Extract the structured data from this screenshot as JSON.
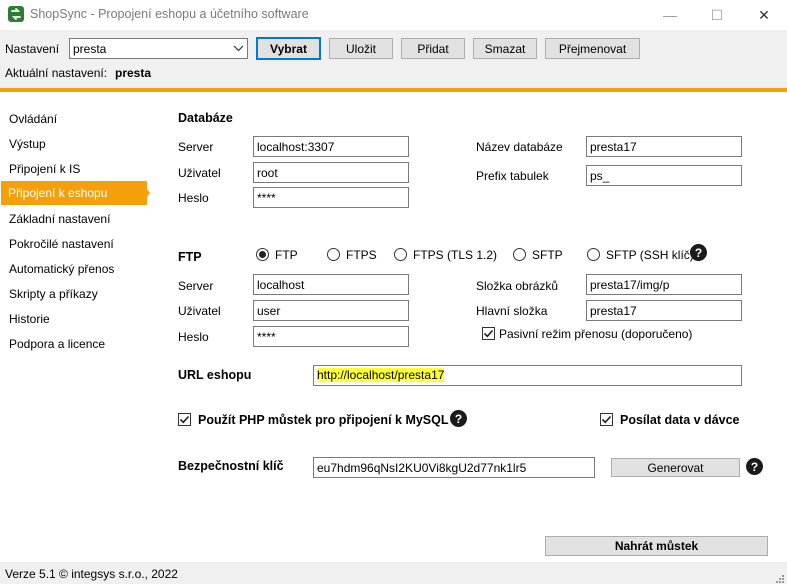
{
  "window": {
    "title": "ShopSync - Propojení eshopu a účetního software",
    "minimize": "—",
    "maximize": "☐",
    "close": "✕"
  },
  "config": {
    "label": "Nastavení",
    "selected": "presta",
    "current_label": "Aktuální nastavení:",
    "current_value": "presta",
    "buttons": {
      "select": "Vybrat",
      "save": "Uložit",
      "add": "Přidat",
      "delete": "Smazat",
      "rename": "Přejmenovat"
    }
  },
  "sidebar": {
    "items": [
      {
        "label": "Ovládání"
      },
      {
        "label": "Výstup"
      },
      {
        "label": "Připojení k IS"
      },
      {
        "label": "Připojení k eshopu"
      },
      {
        "label": "Základní nastavení"
      },
      {
        "label": "Pokročilé nastavení"
      },
      {
        "label": "Automatický přenos"
      },
      {
        "label": "Skripty a příkazy"
      },
      {
        "label": "Historie"
      },
      {
        "label": "Podpora a licence"
      }
    ],
    "active_index": 3
  },
  "database": {
    "heading": "Databáze",
    "server_label": "Server",
    "server": "localhost:3307",
    "user_label": "Uživatel",
    "user": "root",
    "password_label": "Heslo",
    "password": "****",
    "dbname_label": "Název databáze",
    "dbname": "presta17",
    "prefix_label": "Prefix tabulek",
    "prefix": "ps_"
  },
  "ftp": {
    "heading": "FTP",
    "options": [
      {
        "label": "FTP",
        "selected": true
      },
      {
        "label": "FTPS",
        "selected": false
      },
      {
        "label": "FTPS (TLS 1.2)",
        "selected": false
      },
      {
        "label": "SFTP",
        "selected": false
      },
      {
        "label": "SFTP (SSH klíč)",
        "selected": false
      }
    ],
    "server_label": "Server",
    "server": "localhost",
    "user_label": "Uživatel",
    "user": "user",
    "password_label": "Heslo",
    "password": "****",
    "images_label": "Složka obrázků",
    "images": "presta17/img/p",
    "main_label": "Hlavní složka",
    "main": "presta17",
    "passive_label": "Pasivní režim přenosu (doporučeno)",
    "passive_checked": true
  },
  "url": {
    "label": "URL eshopu",
    "value": "http://localhost/presta17"
  },
  "options": {
    "php_bridge_label": "Použít PHP můstek pro připojení k MySQL",
    "php_bridge_checked": true,
    "batch_label": "Posílat data v dávce",
    "batch_checked": true
  },
  "security": {
    "label": "Bezpečnostní klíč",
    "value": "eu7hdm96qNsI2KU0Vi8kgU2d77nk1lr5",
    "generate": "Generovat"
  },
  "upload_button": "Nahrát můstek",
  "status": {
    "text": "Verze 5.1  © integsys s.r.o., 2022"
  },
  "colors": {
    "accent": "#f5a00a",
    "highlight": "#ffff32",
    "focus_border": "#0078d7"
  }
}
